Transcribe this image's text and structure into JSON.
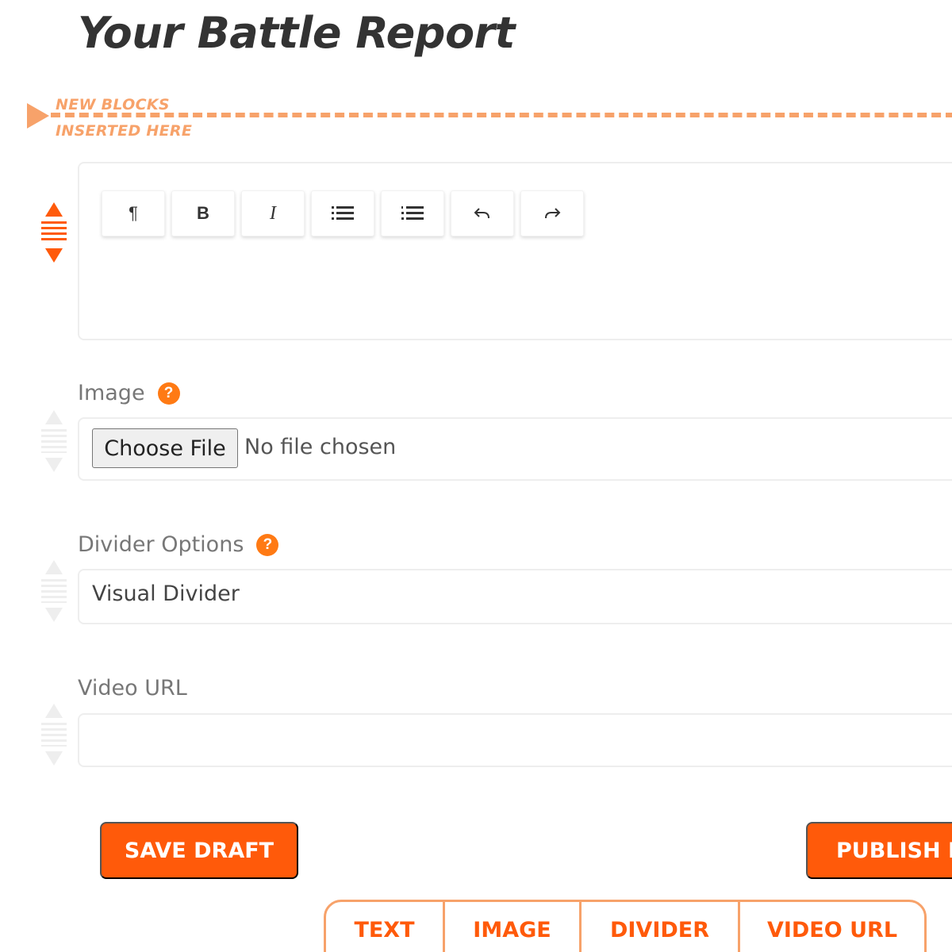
{
  "page": {
    "title": "Your Battle Report"
  },
  "insert_marker": {
    "line1": "NEW BLOCKS",
    "line2": "INSERTED HERE",
    "color": "#f7a26a"
  },
  "editor": {
    "toolbar": [
      {
        "icon": "pilcrow-icon",
        "glyph": "¶"
      },
      {
        "icon": "bold-icon",
        "glyph": "B"
      },
      {
        "icon": "italic-icon",
        "glyph": "I"
      },
      {
        "icon": "bulleted-list-icon",
        "glyph": "☰"
      },
      {
        "icon": "numbered-list-icon",
        "glyph": "☰"
      },
      {
        "icon": "undo-icon",
        "glyph": "↶"
      },
      {
        "icon": "redo-icon",
        "glyph": "↷"
      }
    ]
  },
  "image_field": {
    "label": "Image",
    "help": "?",
    "button": "Choose File",
    "status": "No file chosen"
  },
  "divider_field": {
    "label": "Divider Options",
    "help": "?",
    "value": "Visual Divider"
  },
  "video_field": {
    "label": "Video URL",
    "value": ""
  },
  "actions": {
    "save": "SAVE DRAFT",
    "publish": "PUBLISH B"
  },
  "add_block_tabs": [
    "TEXT",
    "IMAGE",
    "DIVIDER",
    "VIDEO URL"
  ],
  "colors": {
    "accent": "#ff5a0a",
    "accent_light": "#f7a26a",
    "help": "#ff7a14"
  }
}
